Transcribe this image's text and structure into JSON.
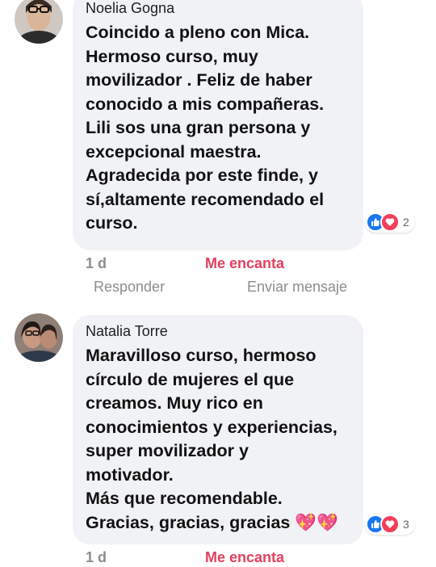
{
  "comments": [
    {
      "author": "Noelia Gogna",
      "text": "Coincido a pleno con Mica.\nHermoso curso, muy\nmovilizador . Feliz de haber\nconocido a mis compañeras.\nLili sos una gran persona  y\nexcepcional maestra.\nAgradecida por este finde, y\nsí,altamente recomendado el\ncurso.",
      "reaction_count": "2",
      "reaction_icons": [
        "like-icon",
        "love-icon"
      ],
      "time": "1 d",
      "love_label": "Me encanta",
      "reply_label": "Responder",
      "message_label": "Enviar mensaje"
    },
    {
      "author": "Natalia Torre",
      "text": "Maravilloso curso, hermoso\ncírculo de mujeres el que\ncreamos.  Muy rico en\nconocimientos y experiencias,\nsuper movilizador y\nmotivador.\nMás que recomendable.\nGracias, gracias, gracias",
      "text_emoji": "💖💖",
      "reaction_count": "3",
      "reaction_icons": [
        "like-icon",
        "love-icon"
      ],
      "time": "1 d",
      "love_label": "Me encanta"
    }
  ],
  "colors": {
    "bubble": "#f0f2f5",
    "like": "#1877f2",
    "love": "#f33e58",
    "love_link": "#e4405f",
    "meta": "#8a8d91"
  }
}
